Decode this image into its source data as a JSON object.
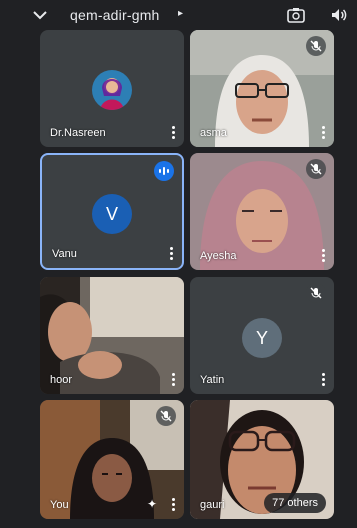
{
  "meeting": {
    "title": "qem-adir-gmh"
  },
  "icons": {
    "back": "chevron-down-icon",
    "switch_camera": "switch-camera-icon",
    "audio": "speaker-icon",
    "mic_off": "mic-off-icon",
    "speaking": "audio-wave-icon",
    "more": "more-vert-icon"
  },
  "colors": {
    "background": "#202124",
    "tile": "#3c4043",
    "active_border": "#8ab4f8",
    "speaking_badge": "#1a73e8",
    "avatar_v": "#1a5fb4",
    "avatar_y": "#5f6e7a"
  },
  "participants": [
    {
      "name": "Dr.Nasreen",
      "muted": false,
      "avatar": "photo"
    },
    {
      "name": "asma",
      "muted": true,
      "avatar": "video"
    },
    {
      "name": "Vanu",
      "muted": false,
      "speaking": true,
      "avatar_letter": "V"
    },
    {
      "name": "Ayesha",
      "muted": true,
      "avatar": "video"
    },
    {
      "name": "hoor",
      "muted": false,
      "avatar": "video"
    },
    {
      "name": "Yatin",
      "muted": true,
      "avatar_letter": "Y"
    },
    {
      "name": "You",
      "muted": true,
      "avatar": "video"
    },
    {
      "name": "gauri",
      "muted": false,
      "avatar": "video"
    }
  ],
  "others_label": "77 others"
}
